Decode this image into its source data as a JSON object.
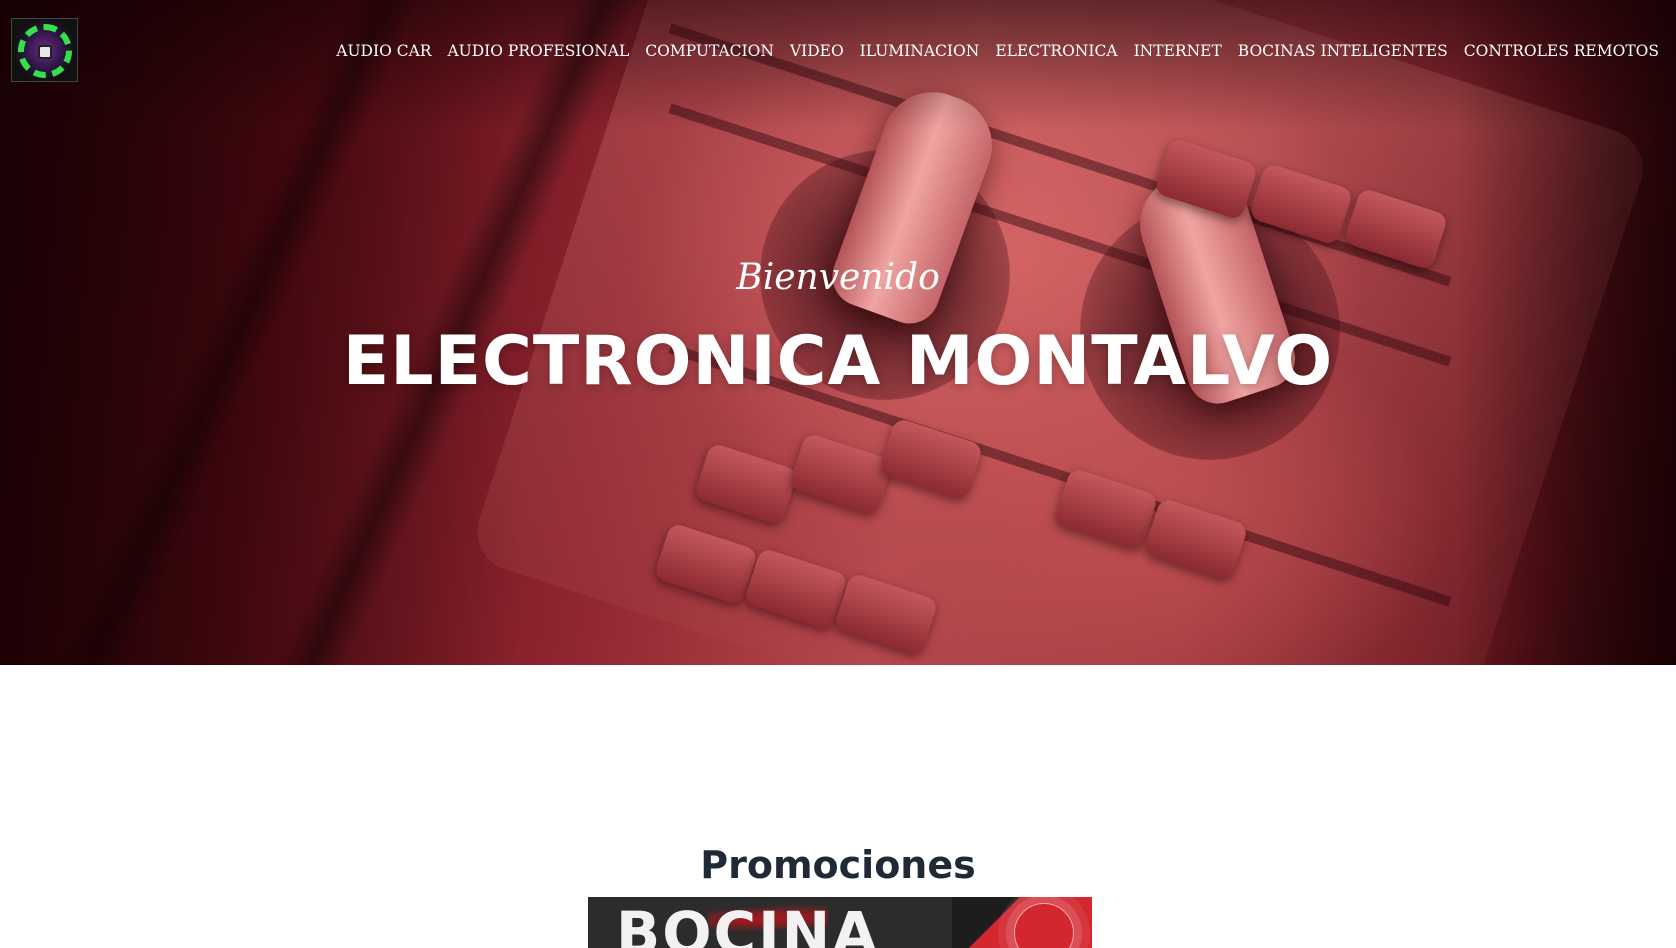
{
  "brand": {
    "logo_icon": "store-logo-speaker-emblem"
  },
  "nav": {
    "items": [
      {
        "label": "AUDIO CAR"
      },
      {
        "label": "AUDIO PROFESIONAL"
      },
      {
        "label": "COMPUTACION"
      },
      {
        "label": "VIDEO"
      },
      {
        "label": "ILUMINACION"
      },
      {
        "label": "ELECTRONICA"
      },
      {
        "label": "INTERNET"
      },
      {
        "label": "BOCINAS INTELIGENTES"
      },
      {
        "label": "CONTROLES REMOTOS"
      }
    ]
  },
  "hero": {
    "subtitle": "Bienvenido",
    "title": "ELECTRONICA MONTALVO",
    "background_tint": "#b8474d"
  },
  "promos": {
    "heading": "Promociones",
    "banner_text": "BOCINA"
  },
  "colors": {
    "heading_text": "#1f2a36",
    "nav_text": "#ffffff",
    "banner_red": "#d3262f"
  }
}
